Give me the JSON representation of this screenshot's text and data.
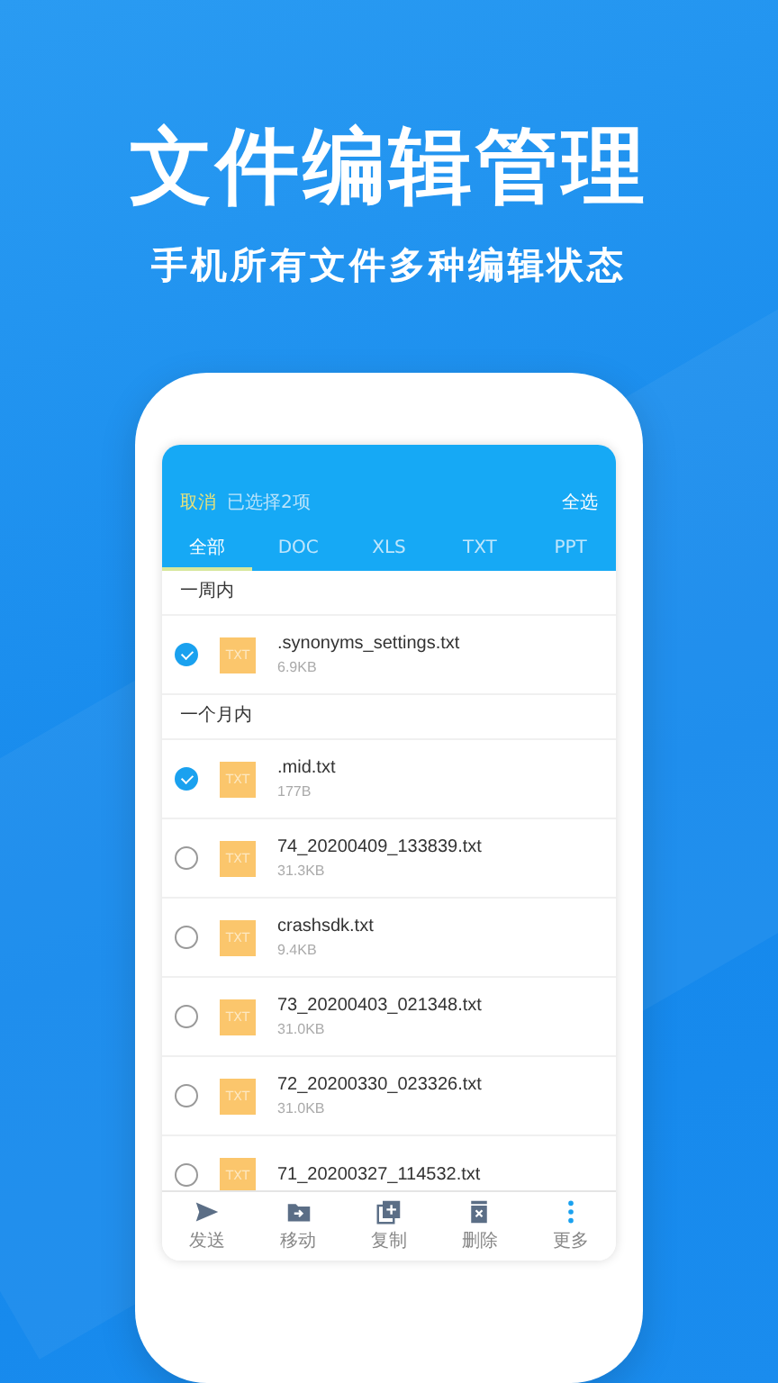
{
  "headline": "文件编辑管理",
  "subtitle": "手机所有文件多种编辑状态",
  "header": {
    "cancel": "取消",
    "selection_count": "已选择2项",
    "select_all": "全选"
  },
  "tabs": [
    {
      "label": "全部",
      "selected": true
    },
    {
      "label": "DOC",
      "selected": false
    },
    {
      "label": "XLS",
      "selected": false
    },
    {
      "label": "TXT",
      "selected": false
    },
    {
      "label": "PPT",
      "selected": false
    }
  ],
  "sections": [
    {
      "title": "一周内",
      "files": [
        {
          "badge": "TXT",
          "name": ".synonyms_settings.txt",
          "size": "6.9KB",
          "selected": true
        }
      ]
    },
    {
      "title": "一个月内",
      "files": [
        {
          "badge": "TXT",
          "name": ".mid.txt",
          "size": "177B",
          "selected": true
        },
        {
          "badge": "TXT",
          "name": "74_20200409_133839.txt",
          "size": "31.3KB",
          "selected": false
        },
        {
          "badge": "TXT",
          "name": "crashsdk.txt",
          "size": "9.4KB",
          "selected": false
        },
        {
          "badge": "TXT",
          "name": "73_20200403_021348.txt",
          "size": "31.0KB",
          "selected": false
        },
        {
          "badge": "TXT",
          "name": "72_20200330_023326.txt",
          "size": "31.0KB",
          "selected": false
        },
        {
          "badge": "TXT",
          "name": "71_20200327_114532.txt",
          "selected": false
        }
      ]
    }
  ],
  "actions": [
    {
      "label": "发送"
    },
    {
      "label": "移动"
    },
    {
      "label": "复制"
    },
    {
      "label": "删除"
    },
    {
      "label": "更多"
    }
  ]
}
